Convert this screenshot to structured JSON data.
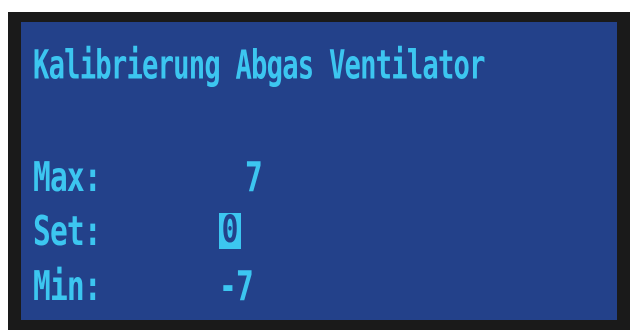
{
  "screen": {
    "title": "Kalibrierung Abgas Ventilator",
    "rows": [
      {
        "label": "Max:",
        "value": "7"
      },
      {
        "label": "Set:",
        "value": "0"
      },
      {
        "label": "Min:",
        "value": "-7"
      }
    ]
  },
  "colors": {
    "screen_background": "#23418a",
    "text": "#3cc6f0",
    "bezel": "#1a1a1a"
  }
}
